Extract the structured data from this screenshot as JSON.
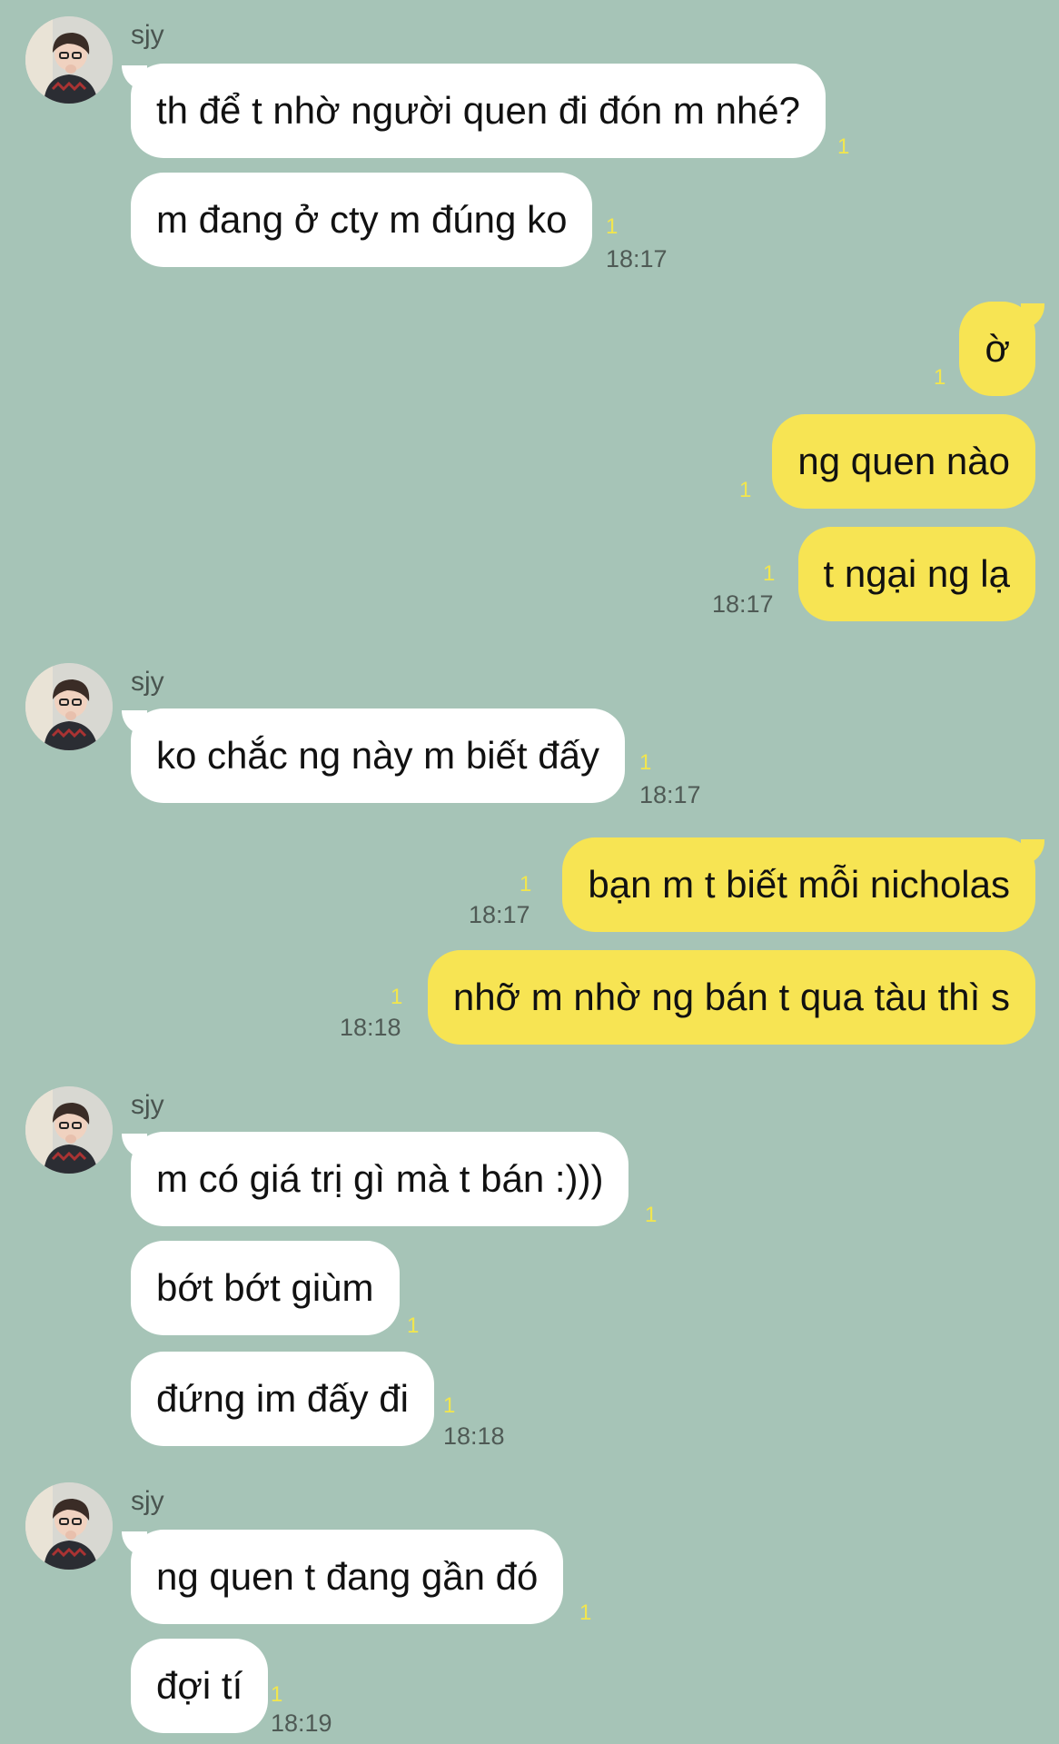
{
  "colors": {
    "background": "#a6c4b7",
    "incoming_bubble": "#ffffff",
    "outgoing_bubble": "#f7e453",
    "unread_count": "#f2e64d",
    "timestamp": "#4f5a55"
  },
  "sender_name": "sjy",
  "messages": [
    {
      "text": "th để t nhờ người quen đi đón m nhé?",
      "unread": "1"
    },
    {
      "text": "m đang ở cty m đúng ko",
      "unread": "1",
      "time": "18:17"
    },
    {
      "text": "ờ",
      "unread": "1"
    },
    {
      "text": "ng quen nào",
      "unread": "1"
    },
    {
      "text": "t ngại ng lạ",
      "unread": "1",
      "time": "18:17"
    },
    {
      "text": "ko chắc ng này m biết đấy",
      "unread": "1",
      "time": "18:17"
    },
    {
      "text": "bạn m t biết mỗi nicholas",
      "unread": "1",
      "time": "18:17"
    },
    {
      "text": "nhỡ m nhờ ng bán t qua tàu thì s",
      "unread": "1",
      "time": "18:18"
    },
    {
      "text": "m có giá trị gì mà t bán :)))",
      "unread": "1"
    },
    {
      "text": "bớt bớt giùm",
      "unread": "1"
    },
    {
      "text": "đứng im đấy đi",
      "unread": "1",
      "time": "18:18"
    },
    {
      "text": "ng quen t đang gần đó",
      "unread": "1"
    },
    {
      "text": "đợi tí",
      "unread": "1",
      "time": "18:19"
    }
  ]
}
